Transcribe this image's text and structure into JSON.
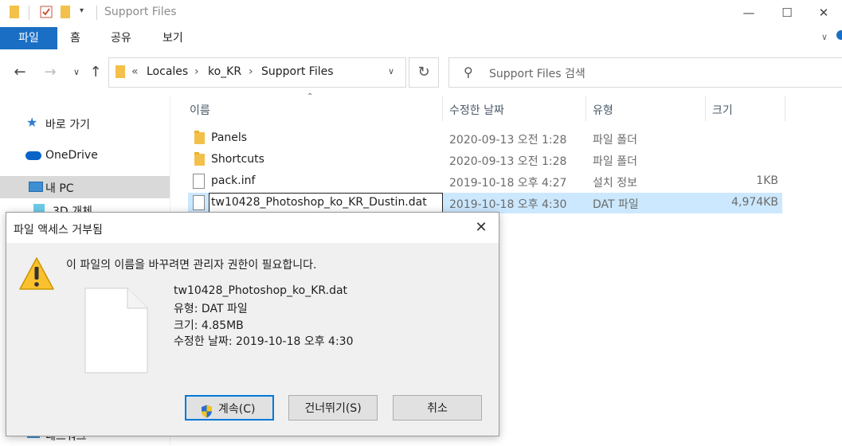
{
  "window": {
    "title": "Support Files",
    "minimize_icon": "minimize-icon",
    "maximize_icon": "maximize-icon",
    "close_icon": "close-icon"
  },
  "ribbon": {
    "tabs": [
      "파일",
      "홈",
      "공유",
      "보기"
    ]
  },
  "address": {
    "prefix": "«",
    "crumbs": [
      "Locales",
      "ko_KR",
      "Support Files"
    ],
    "search_placeholder": "Support Files 검색"
  },
  "nav": {
    "items": [
      {
        "label": "바로 가기",
        "icon": "star-icon"
      },
      {
        "label": "OneDrive",
        "icon": "cloud-icon"
      },
      {
        "label": "내 PC",
        "icon": "computer-icon"
      },
      {
        "label": "3D 개체",
        "icon": "cube-icon"
      },
      {
        "label": "네트워크",
        "icon": "network-icon"
      }
    ]
  },
  "columns": [
    "이름",
    "수정한 날짜",
    "유형",
    "크기"
  ],
  "files": [
    {
      "name": "Panels",
      "date": "2020-09-13 오전 1:28",
      "type": "파일 폴더",
      "size": "",
      "kind": "folder"
    },
    {
      "name": "Shortcuts",
      "date": "2020-09-13 오전 1:28",
      "type": "파일 폴더",
      "size": "",
      "kind": "folder"
    },
    {
      "name": "pack.inf",
      "date": "2019-10-18 오후 4:27",
      "type": "설치 정보",
      "size": "1KB",
      "kind": "file"
    },
    {
      "name": "tw10428_Photoshop_ko_KR_Dustin.dat",
      "date": "2019-10-18 오후 4:30",
      "type": "DAT 파일",
      "size": "4,974KB",
      "kind": "file",
      "selected": true
    }
  ],
  "dialog": {
    "title": "파일 액세스 거부됨",
    "message": "이 파일의 이름을 바꾸려면 관리자 권한이 필요합니다.",
    "file_name": "tw10428_Photoshop_ko_KR.dat",
    "file_type": "유형: DAT 파일",
    "file_size": "크기: 4.85MB",
    "file_date": "수정한 날짜: 2019-10-18 오후 4:30",
    "buttons": {
      "continue": "계속(C)",
      "skip": "건너뛰기(S)",
      "cancel": "취소"
    }
  },
  "colors": {
    "accent": "#1a6fc4",
    "selection": "#cce8ff"
  }
}
